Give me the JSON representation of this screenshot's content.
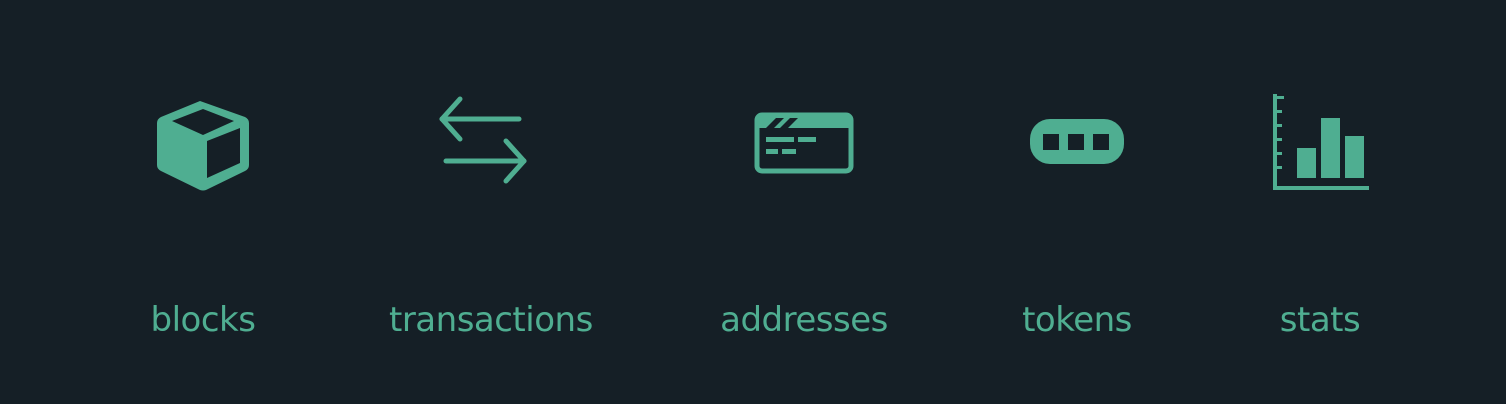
{
  "theme": {
    "background": "#151f26",
    "accent": "#4fae91"
  },
  "nav": {
    "items": [
      {
        "id": "blocks",
        "label": "blocks",
        "icon": "cube-icon"
      },
      {
        "id": "transactions",
        "label": "transactions",
        "icon": "arrows-exchange-icon"
      },
      {
        "id": "addresses",
        "label": "addresses",
        "icon": "address-card-icon"
      },
      {
        "id": "tokens",
        "label": "tokens",
        "icon": "token-icon"
      },
      {
        "id": "stats",
        "label": "stats",
        "icon": "bar-chart-icon"
      }
    ]
  }
}
